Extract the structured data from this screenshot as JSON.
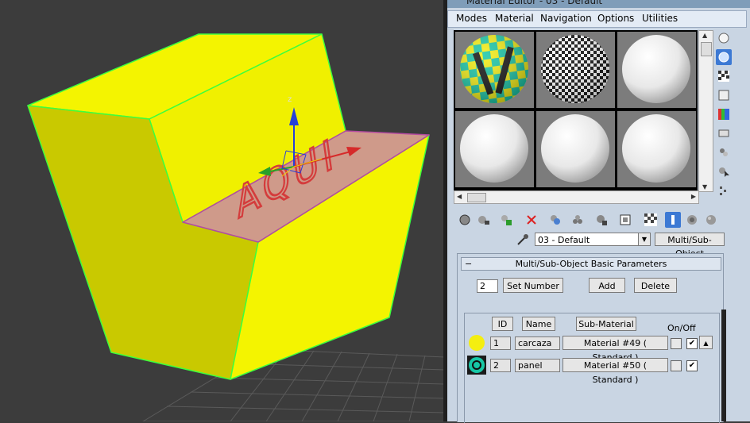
{
  "window": {
    "title": "Material Editor - 03 - Default"
  },
  "menu": [
    "Modes",
    "Material",
    "Navigation",
    "Options",
    "Utilities"
  ],
  "viewport": {
    "gizmo": {
      "z_label": "z"
    },
    "decal_text": "AQUI",
    "colors": {
      "object": "#f4f400",
      "edge": "#3dff3d",
      "panel": "#cf9a8a",
      "background": "#3c3c3c"
    }
  },
  "slots": [
    {
      "kind": "checker-yellow-teal"
    },
    {
      "kind": "checker-black-white"
    },
    {
      "kind": "white-sphere"
    },
    {
      "kind": "white-sphere"
    },
    {
      "kind": "white-sphere"
    },
    {
      "kind": "white-sphere"
    }
  ],
  "side_tools": [
    "sample-type-icon",
    "backlight-icon",
    "background-icon",
    "sample-uv-tiling-icon",
    "video-color-check-icon",
    "make-preview-icon",
    "options-icon",
    "select-by-material-icon",
    "material-map-navigator-icon"
  ],
  "toolbar_icons": [
    "get-material-icon",
    "put-to-scene-icon",
    "assign-to-selection-icon",
    "reset-map-icon",
    "make-unique-icon",
    "put-to-library-icon",
    "material-id-channel-icon",
    "show-shaded-icon",
    "show-end-result-icon",
    "go-to-parent-icon",
    "go-forward-icon",
    "sibling-icon"
  ],
  "material": {
    "name": "03 - Default",
    "type": "Multi/Sub-Object"
  },
  "rollout": {
    "title": "Multi/Sub-Object Basic Parameters",
    "count": "2",
    "set_number": "Set Number",
    "add": "Add",
    "delete": "Delete",
    "headers": {
      "id": "ID",
      "name": "Name",
      "sub_material": "Sub-Material",
      "on_off": "On/Off"
    },
    "rows": [
      {
        "color": "#f4ee10",
        "id": "1",
        "name": "carcaza",
        "sub_material": "Material #49  ( Standard )",
        "on": "✔"
      },
      {
        "color": "#16c7a6",
        "id": "2",
        "name": "panel",
        "sub_material": "Material #50  ( Standard )",
        "on": "✔"
      }
    ]
  }
}
